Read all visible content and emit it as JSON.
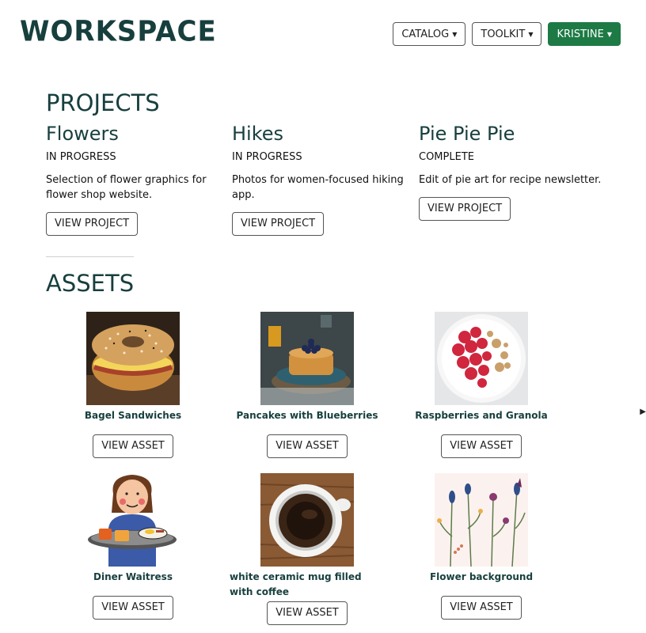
{
  "header": {
    "logo": "WORKSPACE",
    "nav": [
      {
        "label": "CATALOG"
      },
      {
        "label": "TOOLKIT"
      },
      {
        "label": "KRISTINE"
      }
    ]
  },
  "projects": {
    "title": "PROJECTS",
    "items": [
      {
        "name": "Flowers",
        "status": "IN PROGRESS",
        "description": "Selection of flower graphics for flower shop website.",
        "button": "VIEW PROJECT"
      },
      {
        "name": "Hikes",
        "status": "IN PROGRESS",
        "description": "Photos for women-focused hiking app.",
        "button": "VIEW PROJECT"
      },
      {
        "name": "Pie Pie Pie",
        "status": "COMPLETE",
        "description": "Edit of pie art for recipe newsletter.",
        "button": "VIEW PROJECT"
      }
    ]
  },
  "assets": {
    "title": "ASSETS",
    "items": [
      {
        "name": "Bagel Sandwiches",
        "button": "VIEW ASSET"
      },
      {
        "name": "Pancakes with Blueberries",
        "button": "VIEW ASSET"
      },
      {
        "name": "Raspberries and Granola",
        "button": "VIEW ASSET"
      },
      {
        "name": "Diner Waitress",
        "button": "VIEW ASSET"
      },
      {
        "name": "white ceramic mug filled with coffee",
        "button": "VIEW ASSET"
      },
      {
        "name": "Flower background",
        "button": "VIEW ASSET"
      }
    ]
  },
  "colors": {
    "brand": "#173f3e",
    "accent": "#1d7a45"
  }
}
